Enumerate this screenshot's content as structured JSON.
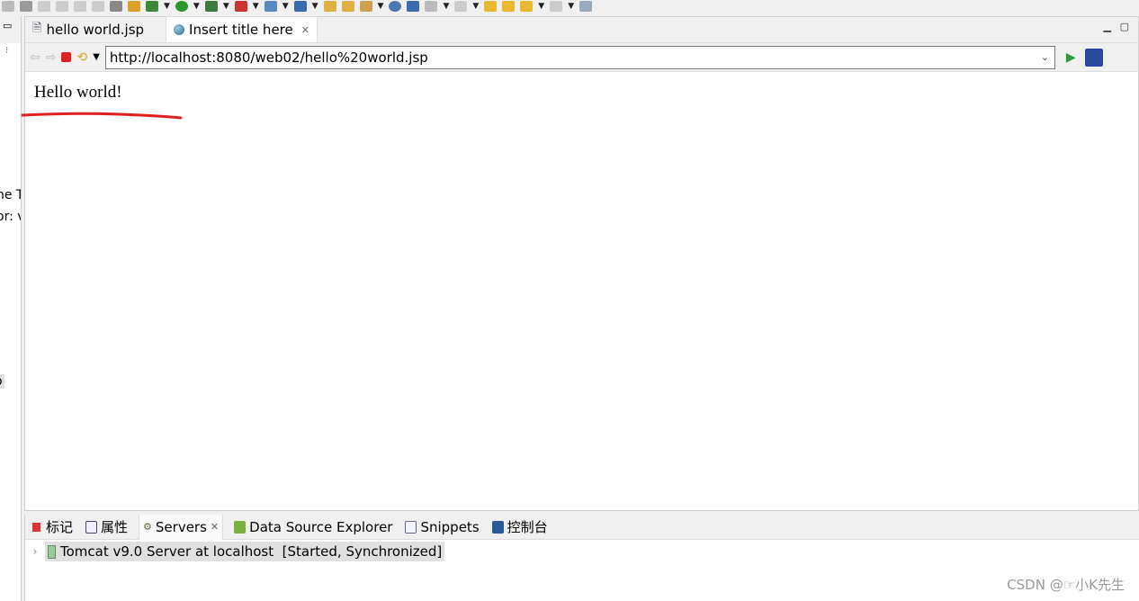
{
  "left_fragments": [
    "ne T",
    "or: v",
    "o"
  ],
  "editor": {
    "tabs": [
      {
        "label": "hello world.jsp",
        "icon": "jsp-file-icon",
        "active": false
      },
      {
        "label": "Insert title here",
        "icon": "globe-icon",
        "active": true
      }
    ],
    "url": "http://localhost:8080/web02/hello%20world.jsp",
    "page_text": "Hello world!"
  },
  "bottom": {
    "tabs": [
      {
        "label": "标记",
        "icon": "markers-icon"
      },
      {
        "label": "属性",
        "icon": "properties-icon"
      },
      {
        "label": "Servers",
        "icon": "servers-icon",
        "active": true
      },
      {
        "label": "Data Source Explorer",
        "icon": "data-source-icon"
      },
      {
        "label": "Snippets",
        "icon": "snippets-icon"
      },
      {
        "label": "控制台",
        "icon": "console-icon"
      }
    ],
    "server": "Tomcat v9.0 Server at localhost  [Started, Synchronized]"
  },
  "watermark": "CSDN @☞小K先生",
  "colors": {
    "annotation": "#e02020"
  }
}
